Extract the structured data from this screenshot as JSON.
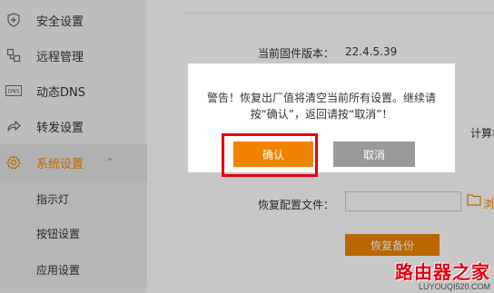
{
  "sidebar": {
    "items": [
      {
        "label": "安全设置",
        "icon": "shield-plus-icon"
      },
      {
        "label": "远程管理",
        "icon": "remote-link-icon"
      },
      {
        "label": "动态DNS",
        "icon": "dns-icon"
      },
      {
        "label": "转发设置",
        "icon": "forward-arrow-icon"
      },
      {
        "label": "系统设置",
        "icon": "gear-icon",
        "expanded_indicator": "⌃"
      }
    ],
    "sub_items": [
      {
        "label": "指示灯"
      },
      {
        "label": "按钮设置"
      },
      {
        "label": "应用设置"
      }
    ]
  },
  "main": {
    "firmware_label": "当前固件版本：",
    "firmware_value": "22.4.5.39",
    "side_partial_text": "计算机",
    "restore_label": "恢复配置文件：",
    "browse_partial": "浏",
    "restore_button": "恢复备份"
  },
  "dialog": {
    "message": "警告！恢复出厂值将清空当前所有设置。继续请按“确认”，返回请按“取消”！",
    "confirm": "确认",
    "cancel": "取消"
  },
  "watermark": {
    "main": "路由器之家",
    "sub": "LUYOUQI520.COM"
  },
  "colors": {
    "accent": "#f08300",
    "highlight": "#e3000f",
    "cancel": "#999999"
  }
}
